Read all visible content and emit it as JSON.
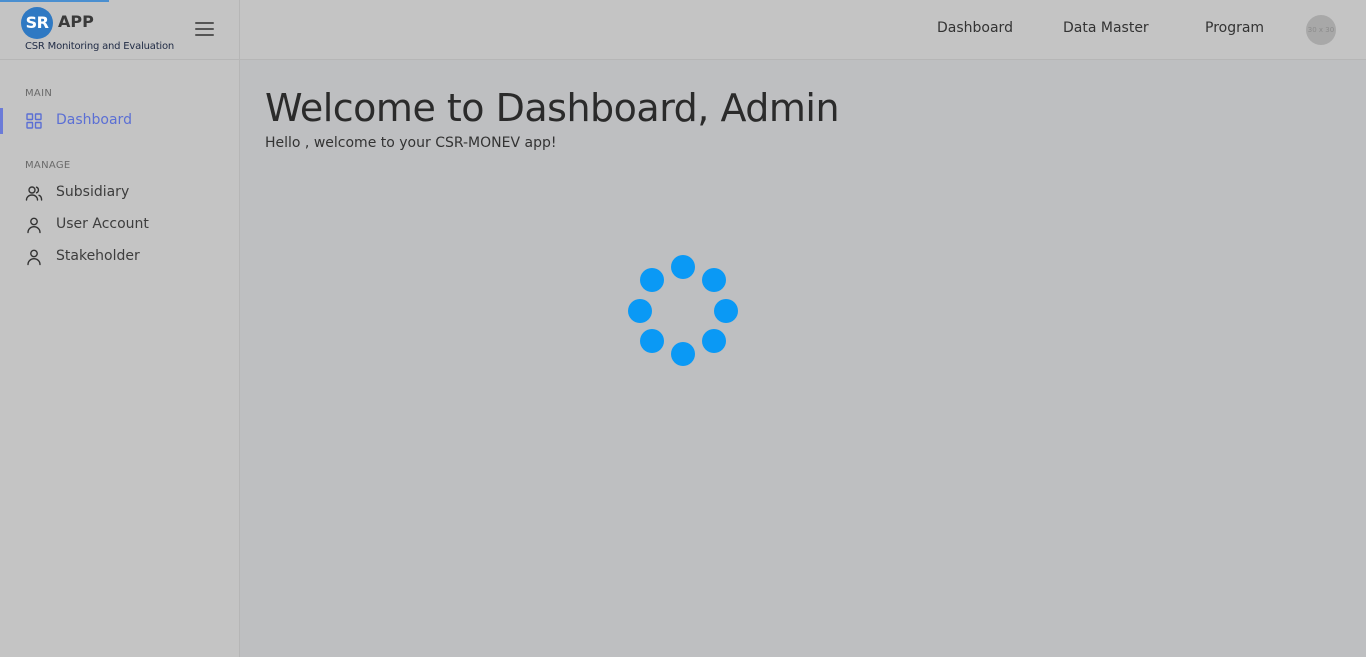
{
  "brand": {
    "logo_initials": "SR",
    "app_name": "APP",
    "subtitle": "CSR Monitoring and Evaluation"
  },
  "sidebar": {
    "sections": [
      {
        "label": "MAIN",
        "items": [
          {
            "label": "Dashboard",
            "icon": "grid-icon",
            "active": true
          }
        ]
      },
      {
        "label": "MANAGE",
        "items": [
          {
            "label": "Subsidiary",
            "icon": "users-icon"
          },
          {
            "label": "User Account",
            "icon": "user-icon"
          },
          {
            "label": "Stakeholder",
            "icon": "user-icon"
          }
        ]
      }
    ]
  },
  "header": {
    "nav": [
      "Dashboard",
      "Data Master",
      "Program"
    ],
    "avatar_text": "30 x 30"
  },
  "main": {
    "title": "Welcome to Dashboard, Admin",
    "subtitle": "Hello , welcome to your CSR-MONEV app!"
  },
  "colors": {
    "accent": "#5b6fd4",
    "loader": "#0a99f5",
    "logo": "#2f79c3"
  }
}
